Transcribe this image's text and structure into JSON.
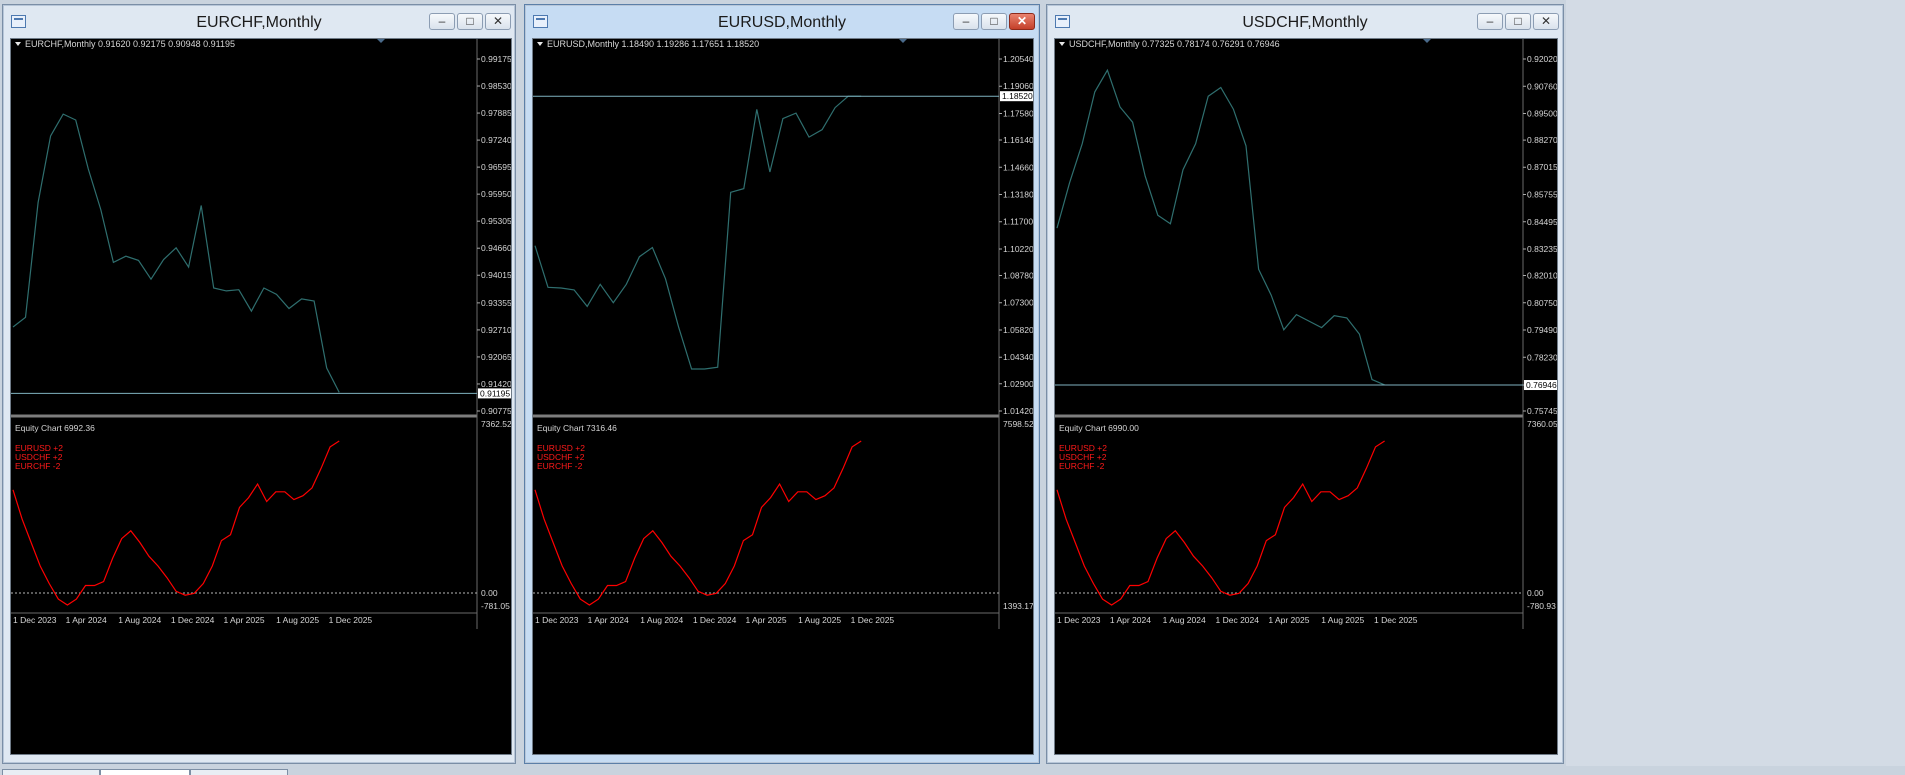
{
  "colors": {
    "background": "#000000",
    "price_line": "#2f6f6f",
    "price_level_line": "#7fb2bf",
    "axis_text": "#d6d6d6",
    "equity_line": "#ff0000",
    "equity_legend": "#ff1a1a",
    "zero_line": "#b8b8b8"
  },
  "icons": {
    "app": "chart-window-icon",
    "minimize": "minimize-icon",
    "restore": "restore-icon",
    "close": "close-icon",
    "menu": "triangle-down-icon"
  },
  "windows": [
    {
      "title": "EURCHF,Monthly",
      "active": false,
      "header": "EURCHF,Monthly  0.91620 0.92175 0.90948 0.91195",
      "price_ticks": [
        "0.99175",
        "0.98530",
        "0.97885",
        "0.97240",
        "0.96595",
        "0.95950",
        "0.95305",
        "0.94660",
        "0.94015",
        "0.93355",
        "0.92710",
        "0.92065",
        "0.91420",
        "0.90775"
      ],
      "price_range": [
        0.90775,
        0.99175
      ],
      "current_price": "0.91195",
      "current_value": 0.91195,
      "equity_label": "Equity Chart 6992.36",
      "equity_max": "7362.52",
      "equity_zero": "0.00",
      "equity_min": "-781.05",
      "legend": [
        "EURUSD +2",
        "USDCHF +2",
        "EURCHF -2"
      ],
      "dates": [
        "1 Dec 2023",
        "1 Apr 2024",
        "1 Aug 2024",
        "1 Dec 2024",
        "1 Apr 2025",
        "1 Aug 2025",
        "1 Dec 2025"
      ],
      "prices": [
        0.9278,
        0.9301,
        0.9575,
        0.9734,
        0.9786,
        0.9772,
        0.9655,
        0.9558,
        0.9432,
        0.9447,
        0.9437,
        0.9392,
        0.9439,
        0.9467,
        0.9421,
        0.9568,
        0.9371,
        0.9364,
        0.9367,
        0.9316,
        0.9371,
        0.9356,
        0.9322,
        0.9345,
        0.934,
        0.918,
        0.9122
      ]
    },
    {
      "title": "EURUSD,Monthly",
      "active": true,
      "header": "EURUSD,Monthly  1.18490 1.19286 1.17651 1.18520",
      "price_ticks": [
        "1.20540",
        "1.19060",
        "1.17580",
        "1.16140",
        "1.14660",
        "1.13180",
        "1.11700",
        "1.10220",
        "1.08780",
        "1.07300",
        "1.05820",
        "1.04340",
        "1.02900",
        "1.01420"
      ],
      "price_range": [
        1.0142,
        1.2054
      ],
      "current_price": "1.18520",
      "current_value": 1.1852,
      "equity_label": "Equity Chart 7316.46",
      "equity_max": "7598.52",
      "equity_zero": "",
      "equity_min": "1393.17",
      "legend": [
        "EURUSD +2",
        "USDCHF +2",
        "EURCHF -2"
      ],
      "dates": [
        "1 Dec 2023",
        "1 Apr 2024",
        "1 Aug 2024",
        "1 Dec 2024",
        "1 Apr 2025",
        "1 Aug 2025",
        "1 Dec 2025"
      ],
      "prices": [
        1.104,
        1.0814,
        1.081,
        1.08,
        1.071,
        1.083,
        1.073,
        1.083,
        1.098,
        1.103,
        1.086,
        1.06,
        1.037,
        1.037,
        1.038,
        1.133,
        1.135,
        1.178,
        1.144,
        1.173,
        1.176,
        1.163,
        1.167,
        1.179,
        1.1852,
        1.1852
      ]
    },
    {
      "title": "USDCHF,Monthly",
      "active": false,
      "header": "USDCHF,Monthly  0.77325 0.78174 0.76291 0.76946",
      "price_ticks": [
        "0.92020",
        "0.90760",
        "0.89500",
        "0.88270",
        "0.87015",
        "0.85755",
        "0.84495",
        "0.83235",
        "0.82010",
        "0.80750",
        "0.79490",
        "0.78230",
        "0.76946",
        "0.75745"
      ],
      "price_range": [
        0.75745,
        0.9202
      ],
      "current_price": "0.76946",
      "current_value": 0.76946,
      "equity_label": "Equity Chart 6990.00",
      "equity_max": "7360.05",
      "equity_zero": "0.00",
      "equity_min": "-780.93",
      "legend": [
        "EURUSD +2",
        "USDCHF +2",
        "EURCHF -2"
      ],
      "dates": [
        "1 Dec 2023",
        "1 Apr 2024",
        "1 Aug 2024",
        "1 Dec 2024",
        "1 Apr 2025",
        "1 Aug 2025",
        "1 Dec 2025"
      ],
      "prices": [
        0.842,
        0.863,
        0.881,
        0.905,
        0.915,
        0.898,
        0.891,
        0.866,
        0.848,
        0.844,
        0.869,
        0.881,
        0.903,
        0.907,
        0.897,
        0.88,
        0.823,
        0.811,
        0.795,
        0.802,
        0.799,
        0.796,
        0.8015,
        0.8005,
        0.793,
        0.772,
        0.7695
      ]
    }
  ],
  "equity_shape": [
    4650,
    3900,
    3300,
    2700,
    2250,
    1850,
    1700,
    1850,
    2200,
    2200,
    2300,
    2900,
    3400,
    3600,
    3300,
    2950,
    2700,
    2400,
    2050,
    1950,
    2000,
    2250,
    2700,
    3350,
    3500,
    4200,
    4450,
    4800,
    4350,
    4600,
    4600,
    4400,
    4500,
    4700,
    5200,
    5750,
    5900
  ]
}
